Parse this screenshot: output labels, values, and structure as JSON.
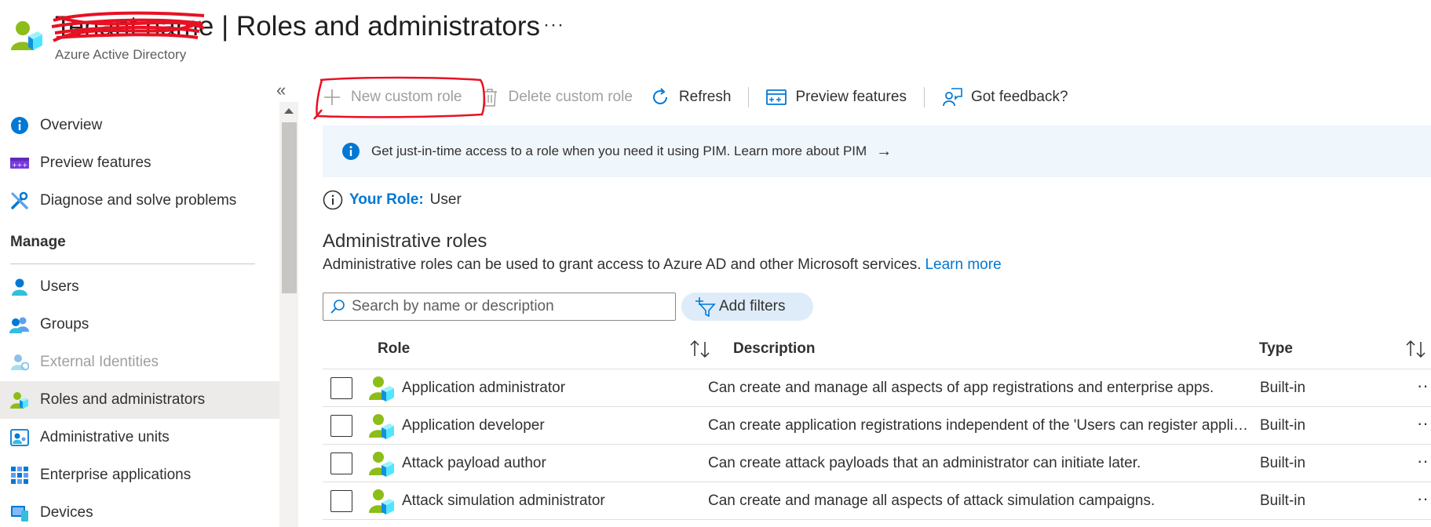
{
  "header": {
    "title_redacted": "Tenant name",
    "title_separator": " | ",
    "title": "Roles and administrators",
    "more_label": "···",
    "subtitle": "Azure Active Directory"
  },
  "sidebar": {
    "collapse_label": "«",
    "items_top": [
      {
        "label": "Overview",
        "icon": "info-icon"
      },
      {
        "label": "Preview features",
        "icon": "preview-features-icon"
      },
      {
        "label": "Diagnose and solve problems",
        "icon": "wrench-icon"
      }
    ],
    "manage_header": "Manage",
    "items_manage": [
      {
        "label": "Users",
        "icon": "user-icon"
      },
      {
        "label": "Groups",
        "icon": "groups-icon"
      },
      {
        "label": "External Identities",
        "icon": "external-identities-icon"
      },
      {
        "label": "Roles and administrators",
        "icon": "roles-icon"
      },
      {
        "label": "Administrative units",
        "icon": "admin-units-icon"
      },
      {
        "label": "Enterprise applications",
        "icon": "enterprise-apps-icon"
      },
      {
        "label": "Devices",
        "icon": "devices-icon"
      }
    ]
  },
  "toolbar": {
    "new_custom_role": "New custom role",
    "delete_custom_role": "Delete custom role",
    "refresh": "Refresh",
    "preview_features": "Preview features",
    "got_feedback": "Got feedback?"
  },
  "banner": {
    "text": "Get just-in-time access to a role when you need it using PIM. Learn more about PIM",
    "arrow": "→"
  },
  "your_role": {
    "label": "Your Role:",
    "value": "User"
  },
  "section": {
    "title": "Administrative roles",
    "description": "Administrative roles can be used to grant access to Azure AD and other Microsoft services.",
    "learn_more": "Learn more"
  },
  "search": {
    "placeholder": "Search by name or description",
    "value": ""
  },
  "filters": {
    "add_filters": "Add filters"
  },
  "table": {
    "columns": {
      "role": "Role",
      "description": "Description",
      "type": "Type"
    },
    "rows": [
      {
        "role": "Application administrator",
        "description": "Can create and manage all aspects of app registrations and enterprise apps.",
        "type": "Built-in"
      },
      {
        "role": "Application developer",
        "description": "Can create application registrations independent of the 'Users can register applications' setting.",
        "type": "Built-in"
      },
      {
        "role": "Attack payload author",
        "description": "Can create attack payloads that an administrator can initiate later.",
        "type": "Built-in"
      },
      {
        "role": "Attack simulation administrator",
        "description": "Can create and manage all aspects of attack simulation campaigns.",
        "type": "Built-in"
      }
    ],
    "row_more_label": "··"
  },
  "colors": {
    "accent": "#0078d4",
    "banner_bg": "#eff6fc",
    "selected_bg": "#edebe9",
    "annotation_red": "#e81123"
  }
}
